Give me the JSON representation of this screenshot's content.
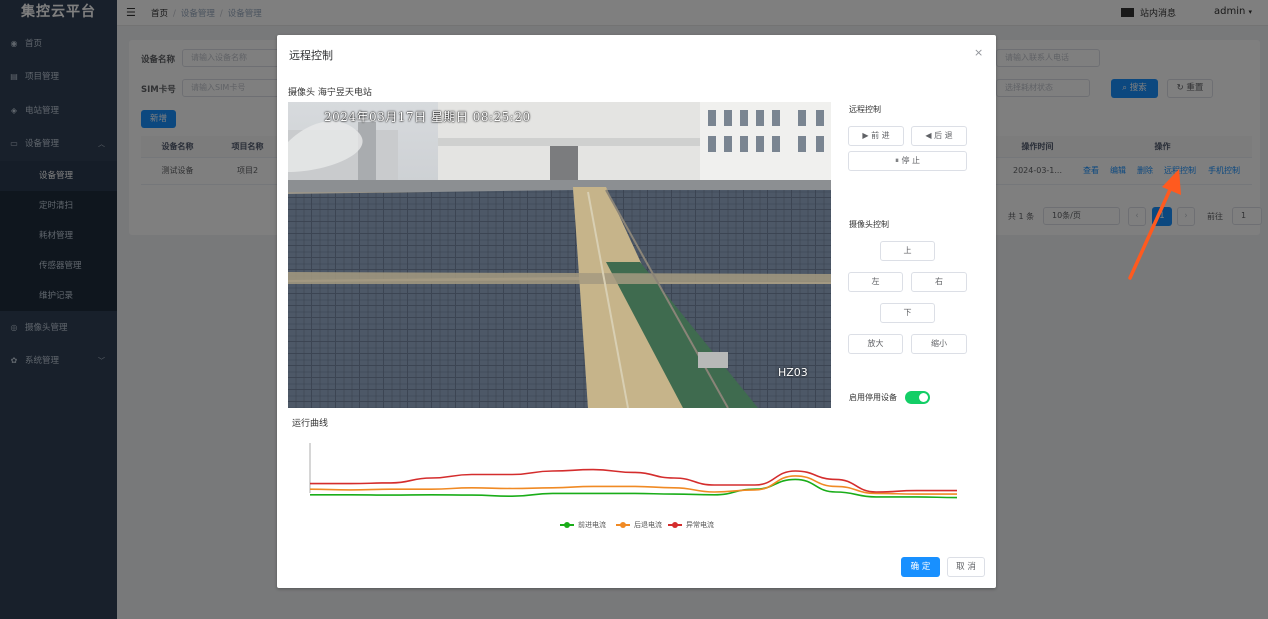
{
  "app": {
    "title": "集控云平台"
  },
  "sidebar": {
    "items": [
      {
        "label": "首页",
        "icon": "dashboard-icon"
      },
      {
        "label": "项目管理",
        "icon": "project-icon"
      },
      {
        "label": "电站管理",
        "icon": "station-icon"
      },
      {
        "label": "设备管理",
        "icon": "device-icon"
      },
      {
        "label": "摄像头管理",
        "icon": "camera-icon"
      },
      {
        "label": "系统管理",
        "icon": "gear-icon"
      }
    ],
    "sub_items": [
      "设备管理",
      "定时清扫",
      "耗材管理",
      "传感器管理",
      "维护记录"
    ]
  },
  "topbar": {
    "breadcrumb": [
      "首页",
      "设备管理",
      "设备管理"
    ],
    "messages": "站内消息",
    "user": "admin"
  },
  "search": {
    "device_name_label": "设备名称",
    "device_name_placeholder": "请输入设备名称",
    "sim_label": "SIM卡号",
    "sim_placeholder": "请输入SIM卡号",
    "phone_placeholder": "请输入联系人电话",
    "status_placeholder": "选择耗材状态",
    "search_label": "搜索",
    "reset_label": "重置",
    "add_label": "新增"
  },
  "table": {
    "headers": [
      "设备名称",
      "项目名称",
      "操作时间",
      "操作"
    ],
    "row": {
      "device": "测试设备",
      "project": "项目2",
      "time": "2024-03-1..."
    },
    "actions": [
      "查看",
      "编辑",
      "删除",
      "远程控制",
      "手机控制"
    ]
  },
  "pagination": {
    "total": "共 1 条",
    "page_size": "10条/页",
    "current": "1",
    "goto_label": "前往",
    "goto_value": "1"
  },
  "dialog": {
    "title": "远程控制",
    "camera_label": "摄像头 海宁昱天电站",
    "osd_text": "2024年03月17日  星期日  08:25:20",
    "camera_id": "HZ03",
    "remote_section": "远程控制",
    "forward": "前 进",
    "backward": "后 退",
    "stop": "停 止",
    "camera_section": "摄像头控制",
    "up": "上",
    "left": "左",
    "right": "右",
    "down": "下",
    "zoom_in": "放大",
    "zoom_out": "缩小",
    "toggle_label": "启用停用设备",
    "toggle_on": true,
    "curve_title": "运行曲线",
    "ok": "确 定",
    "cancel": "取 消"
  },
  "chart_data": {
    "type": "line",
    "title": "运行曲线",
    "series": [
      {
        "name": "前进电流",
        "color": "#1aad19",
        "values": [
          26,
          26,
          25.5,
          26,
          25.5,
          24,
          28,
          28,
          28,
          27,
          26,
          34,
          48,
          30,
          23,
          23,
          22
        ]
      },
      {
        "name": "后退电流",
        "color": "#f08a24",
        "values": [
          34,
          33,
          34,
          34,
          36,
          35,
          36,
          38,
          38,
          36,
          30,
          33,
          53,
          38,
          28,
          27,
          27
        ]
      },
      {
        "name": "异常电流",
        "color": "#d42d2d",
        "values": [
          42,
          42,
          43,
          50,
          55,
          55,
          60,
          62,
          58,
          50,
          40,
          40,
          60,
          48,
          30,
          32,
          32
        ]
      }
    ],
    "ylim": [
      0,
      100
    ],
    "legend": "bottom-center",
    "grid": false
  }
}
